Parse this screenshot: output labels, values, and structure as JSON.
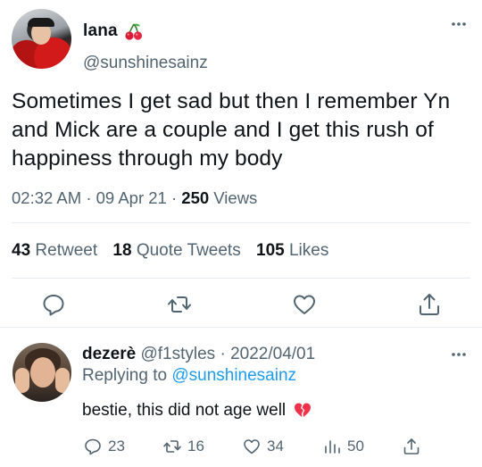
{
  "tweet": {
    "display_name": "lana",
    "handle": "@sunshinesainz",
    "text": "Sometimes I get sad but then I remember Yn and Mick are a couple and I get this rush of happiness through my body",
    "time": "02:32 AM",
    "date": "09 Apr 21",
    "dot": "·",
    "views_count": "250",
    "views_label": "Views",
    "stats": {
      "retweets_count": "43",
      "retweets_label": "Retweet",
      "quotes_count": "18",
      "quotes_label": "Quote Tweets",
      "likes_count": "105",
      "likes_label": "Likes"
    },
    "icons": [
      "cherry-emoji-icon",
      "more-icon",
      "reply-icon",
      "retweet-icon",
      "like-icon",
      "share-icon"
    ]
  },
  "reply": {
    "display_name": "dezerè",
    "handle": "@f1styles",
    "dot": "·",
    "date": "2022/04/01",
    "replying_prefix": "Replying to",
    "replying_to": "@sunshinesainz",
    "text": "bestie, this did not age well",
    "actions": {
      "replies": "23",
      "retweets": "16",
      "likes": "34",
      "views": "50"
    },
    "icons": [
      "broken-heart-emoji-icon",
      "more-icon",
      "reply-icon",
      "retweet-icon",
      "like-icon",
      "views-icon",
      "share-icon"
    ]
  },
  "colors": {
    "text": "#0f1419",
    "secondary": "#536471",
    "link": "#1d9bf0",
    "divider": "#e6ecf0",
    "broken_heart": "#f2314b"
  }
}
